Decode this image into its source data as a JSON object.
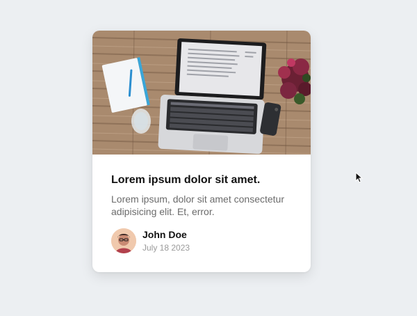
{
  "card": {
    "image": {
      "icon": "laptop-desk-photo"
    },
    "title": "Lorem ipsum dolor sit amet.",
    "description": "Lorem ipsum, dolor sit amet consectetur adipisicing elit. Et, error.",
    "author": {
      "name": "John Doe",
      "date": "July 18 2023",
      "avatar_icon": "user-avatar"
    }
  },
  "colors": {
    "background": "#eceff2",
    "card": "#ffffff",
    "title": "#111111",
    "description": "#6b6b6b",
    "date": "#9a9a9a"
  },
  "cursor": {
    "icon": "mouse-pointer-icon"
  }
}
